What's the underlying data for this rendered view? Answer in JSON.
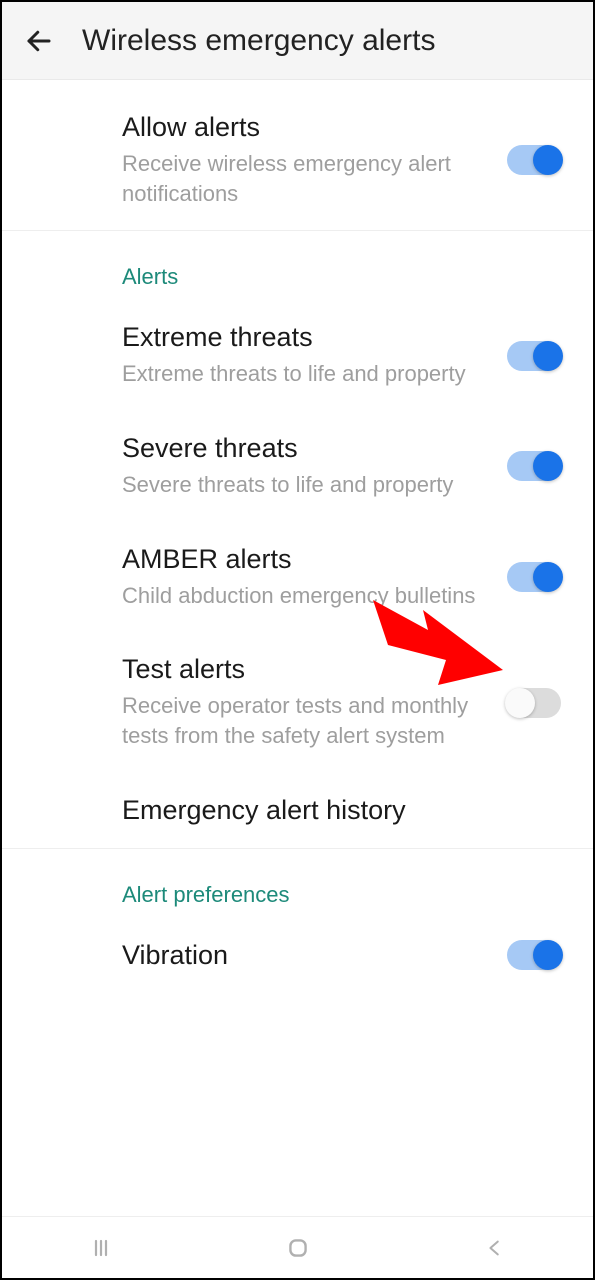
{
  "header": {
    "title": "Wireless emergency alerts"
  },
  "allowAlerts": {
    "title": "Allow alerts",
    "sub": "Receive wireless emergency alert notifications",
    "on": true
  },
  "sections": {
    "alerts": {
      "label": "Alerts",
      "items": [
        {
          "title": "Extreme threats",
          "sub": "Extreme threats to life and property",
          "on": true
        },
        {
          "title": "Severe threats",
          "sub": "Severe threats to life and property",
          "on": true
        },
        {
          "title": "AMBER alerts",
          "sub": "Child abduction emergency bulletins",
          "on": true
        },
        {
          "title": "Test alerts",
          "sub": "Receive operator tests and monthly tests from the safety alert system",
          "on": false
        }
      ],
      "history": {
        "title": "Emergency alert history"
      }
    },
    "prefs": {
      "label": "Alert preferences",
      "items": [
        {
          "title": "Vibration",
          "on": true
        }
      ]
    }
  },
  "annotation": {
    "arrow_color": "#ff0000"
  }
}
